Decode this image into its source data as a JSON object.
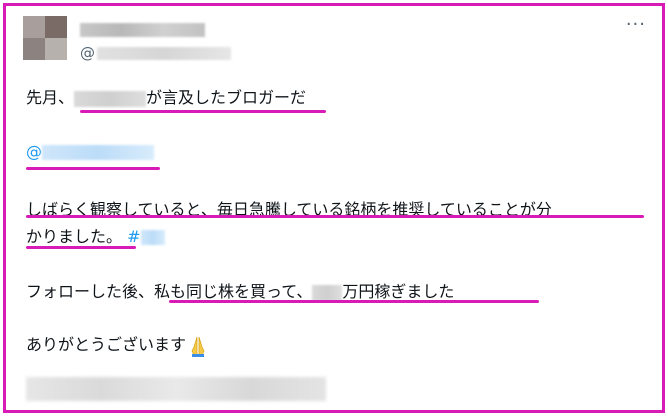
{
  "tweet": {
    "handle_prefix": "@",
    "more_icon": "···",
    "line1_prefix": "先月、",
    "line1_suffix": "が言及したブロガーだ",
    "mention_prefix": "@",
    "line3": "しばらく観察していると、毎日急騰している銘柄を推奨していることが分",
    "line4": "かりました。",
    "hashtag_prefix": "#",
    "line5_prefix": "フォローした後、私も同じ株を買って、",
    "line5_suffix": "万円稼ぎました",
    "line6": "ありがとうございます",
    "emoji_name": "folded-hands-icon"
  },
  "colors": {
    "border": "#d81bb6",
    "underline": "#d81bb6",
    "link": "#1d9bf0",
    "text": "#0f1419",
    "muted": "#536471"
  }
}
